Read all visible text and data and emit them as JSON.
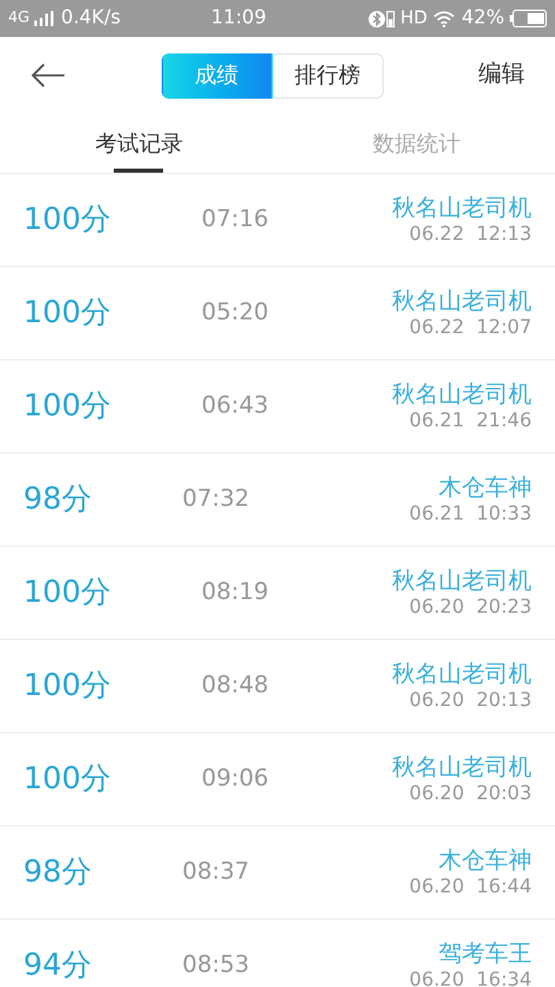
{
  "status_bar": {
    "network": "4G",
    "speed": "0.4K/s",
    "time": "11:09",
    "hd": "HD",
    "battery": "42%"
  },
  "header": {
    "segments": [
      {
        "label": "成绩",
        "selected": true
      },
      {
        "label": "排行榜",
        "selected": false
      }
    ],
    "action": "编辑"
  },
  "tabs": [
    {
      "label": "考试记录",
      "selected": true
    },
    {
      "label": "数据统计",
      "selected": false
    }
  ],
  "records": [
    {
      "score": "100分",
      "duration": "07:16",
      "name": "秋名山老司机",
      "date": "06.22  12:13"
    },
    {
      "score": "100分",
      "duration": "05:20",
      "name": "秋名山老司机",
      "date": "06.22  12:07"
    },
    {
      "score": "100分",
      "duration": "06:43",
      "name": "秋名山老司机",
      "date": "06.21  21:46"
    },
    {
      "score": "98分",
      "duration": "07:32",
      "name": "木仓车神",
      "date": "06.21  10:33"
    },
    {
      "score": "100分",
      "duration": "08:19",
      "name": "秋名山老司机",
      "date": "06.20  20:23"
    },
    {
      "score": "100分",
      "duration": "08:48",
      "name": "秋名山老司机",
      "date": "06.20  20:13"
    },
    {
      "score": "100分",
      "duration": "09:06",
      "name": "秋名山老司机",
      "date": "06.20  20:03"
    },
    {
      "score": "98分",
      "duration": "08:37",
      "name": "木仓车神",
      "date": "06.20  16:44"
    },
    {
      "score": "94分",
      "duration": "08:53",
      "name": "驾考车王",
      "date": "06.20  16:34"
    }
  ]
}
